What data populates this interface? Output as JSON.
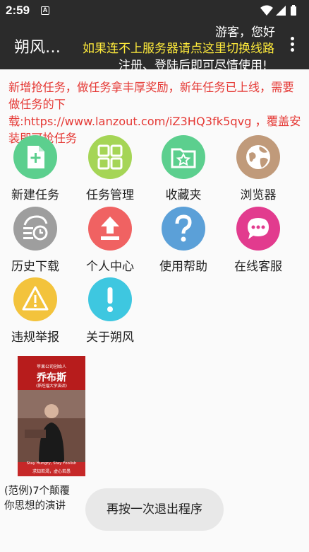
{
  "status_bar": {
    "time": "2:59",
    "notification_letter": "A"
  },
  "app_bar": {
    "title": "朔风…",
    "greeting": "游客，您好",
    "switch_line_link": "如果连不上服务器请点这里切换线路",
    "register_tip": "注册、登陆后即可尽情使用!"
  },
  "notice": "新增抢任务，做任务拿丰厚奖励，新年任务已上线，需要做任务的下载:https://www.lanzout.com/iZ3HQ3fk5qvg ，覆盖安装即可抢任务",
  "menu": [
    {
      "label": "新建任务",
      "icon": "new-task-icon",
      "color": "#5ccf8e"
    },
    {
      "label": "任务管理",
      "icon": "task-manage-icon",
      "color": "#a5d556"
    },
    {
      "label": "收藏夹",
      "icon": "favorites-icon",
      "color": "#5ccf8e"
    },
    {
      "label": "浏览器",
      "icon": "browser-icon",
      "color": "#c09a7a"
    },
    {
      "label": "历史下载",
      "icon": "history-icon",
      "color": "#9e9e9e"
    },
    {
      "label": "个人中心",
      "icon": "user-center-icon",
      "color": "#f06262"
    },
    {
      "label": "使用帮助",
      "icon": "help-icon",
      "color": "#5ba0d8"
    },
    {
      "label": "在线客服",
      "icon": "chat-icon",
      "color": "#e23b8e"
    },
    {
      "label": "违规举报",
      "icon": "warning-icon",
      "color": "#f3c33c"
    },
    {
      "label": "关于朔风",
      "icon": "info-icon",
      "color": "#3ec7e0"
    }
  ],
  "example_item": {
    "cover": {
      "top_text": "苹果公司创始人",
      "title": "乔布斯",
      "subtitle": "《斯坦福大学演讲》",
      "quote_en": "Stay Hungry, Stay Foolish",
      "quote_cn": "求知若渴，虚心若愚"
    },
    "label": "(范例)7个颠覆你思想的演讲"
  },
  "toast": "再按一次退出程序"
}
